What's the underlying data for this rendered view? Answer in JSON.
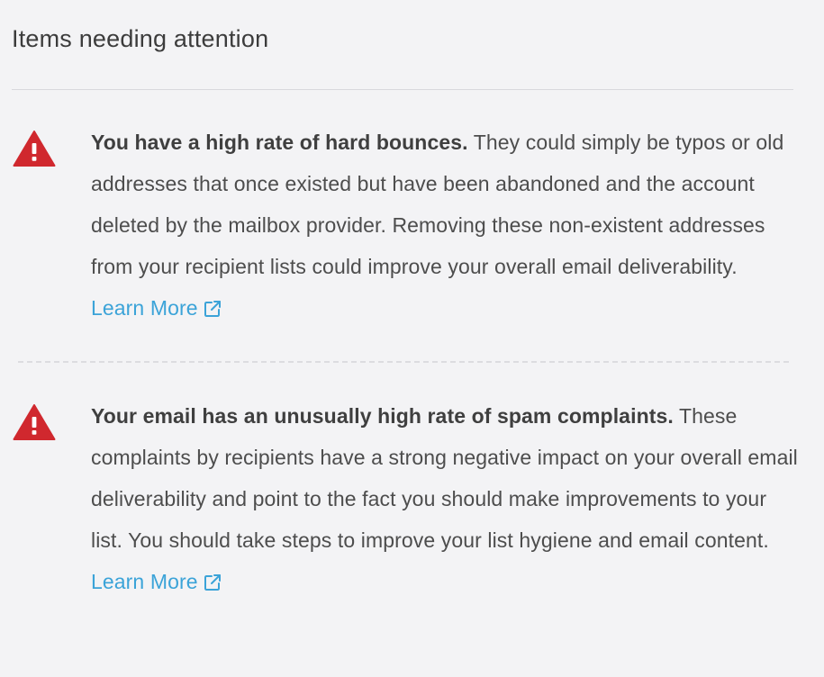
{
  "panel": {
    "title": "Items needing attention"
  },
  "alerts": [
    {
      "severity_color": "#d0282e",
      "icon": "warning-triangle-icon",
      "headline": "You have a high rate of hard bounces.",
      "body": "They could simply be typos or old addresses that once existed but have been abandoned and the account deleted by the mailbox provider. Removing these non-existent addresses from your recipient lists could improve your overall email deliverability.",
      "link_label": "Learn More",
      "link_icon": "external-link-icon"
    },
    {
      "severity_color": "#d0282e",
      "icon": "warning-triangle-icon",
      "headline": "Your email has an unusually high rate of spam complaints.",
      "body": "These complaints by recipients have a strong negative impact on your overall email deliverability and point to the fact you should make improvements to your list. You should take steps to improve your list hygiene and email content.",
      "link_label": "Learn More",
      "link_icon": "external-link-icon"
    }
  ],
  "colors": {
    "link": "#3ba3d8",
    "text": "#4d4d4d",
    "background": "#f3f3f5"
  }
}
